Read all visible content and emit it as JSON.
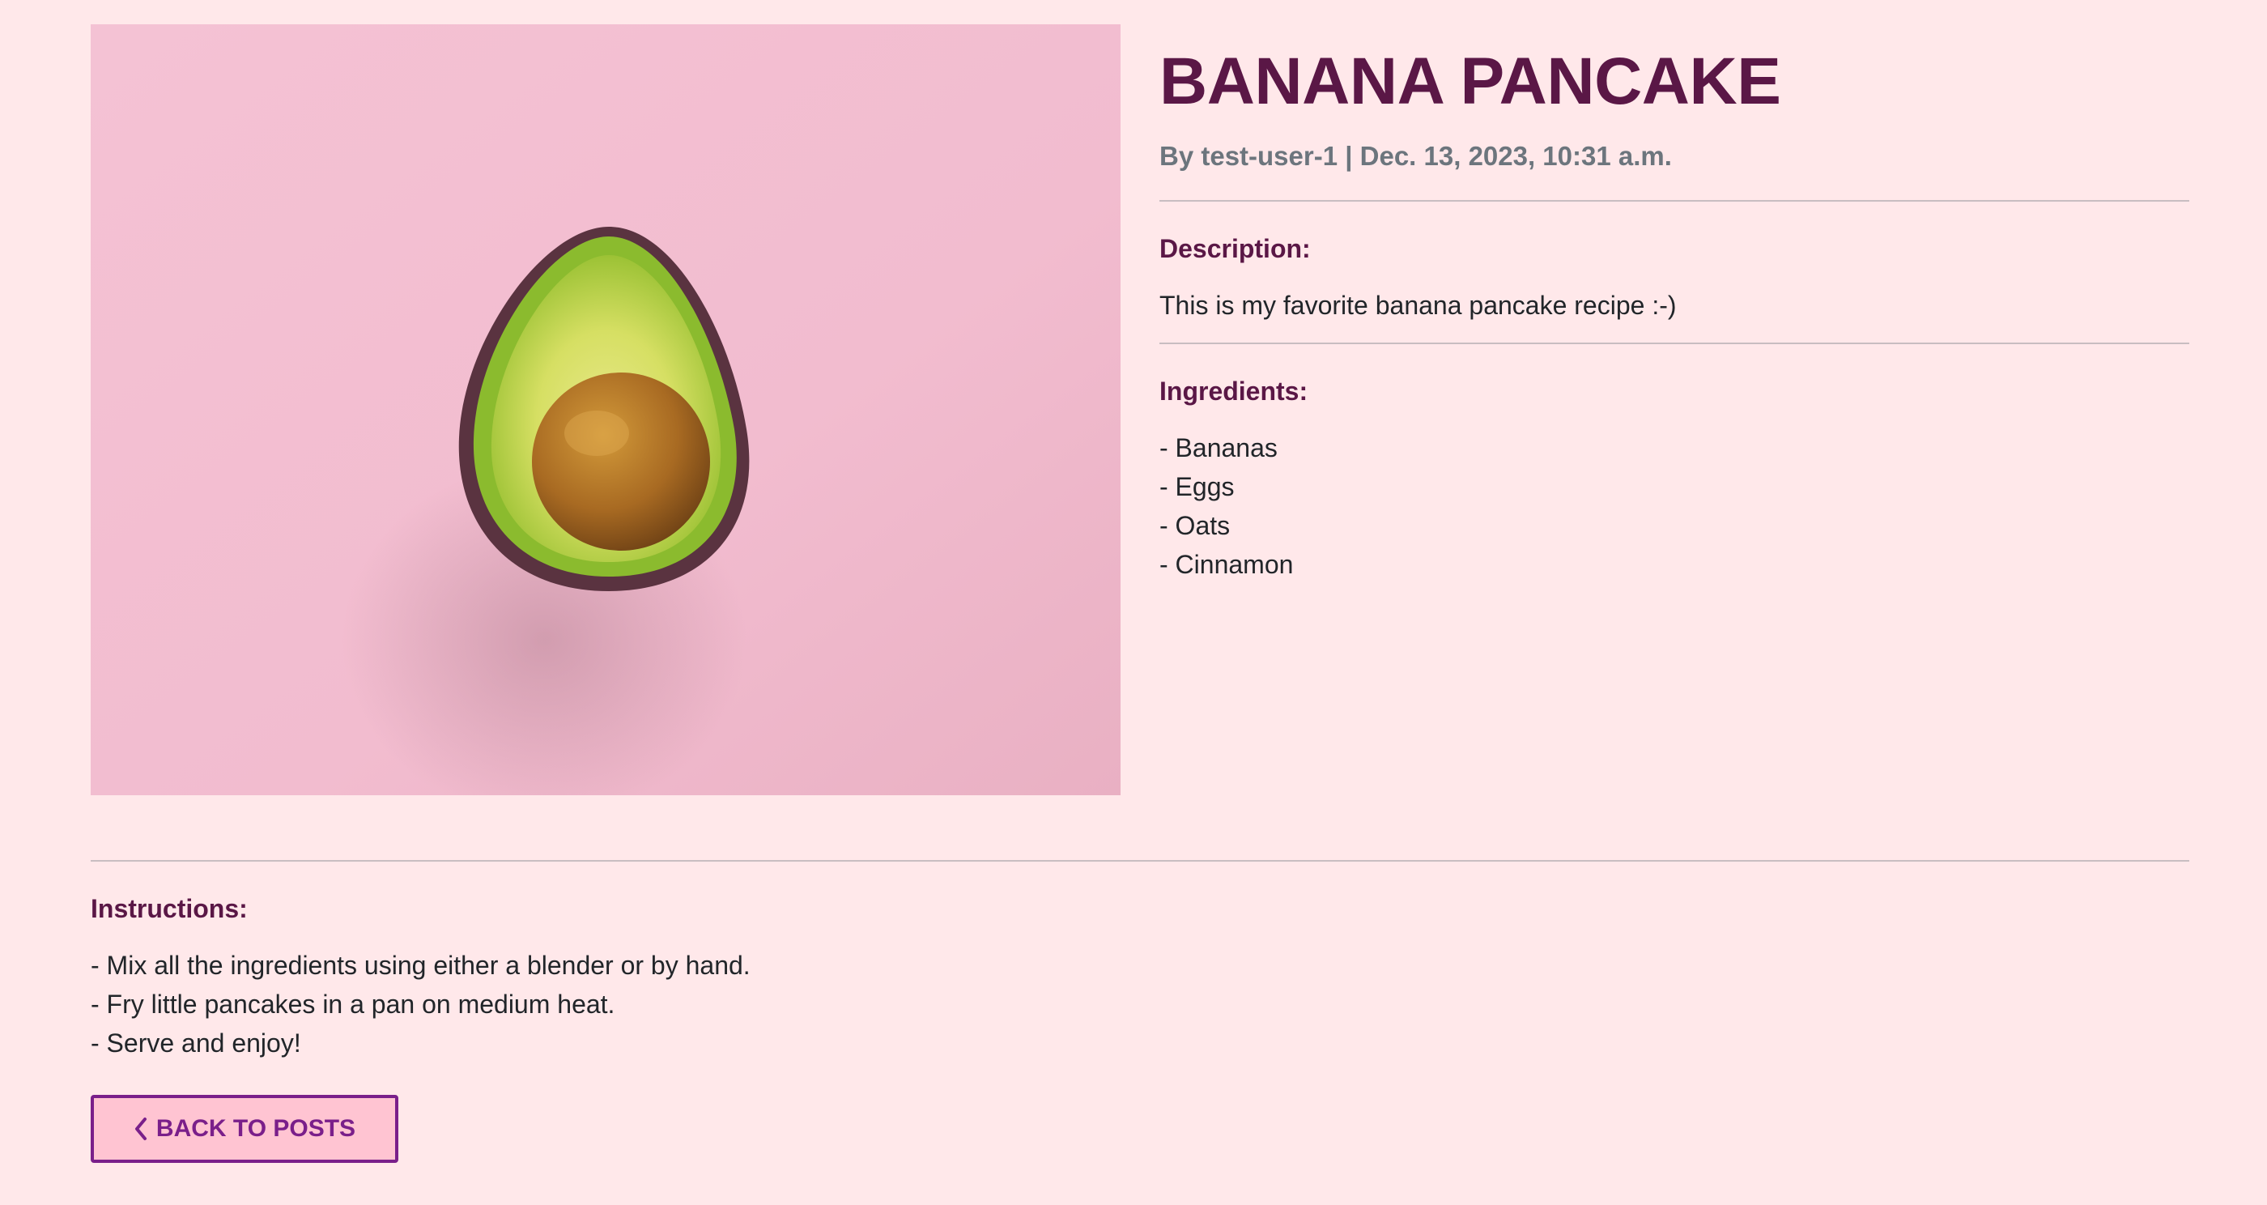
{
  "post": {
    "title": "BANANA PANCAKE",
    "meta": "By test-user-1 | Dec. 13, 2023, 10:31 a.m.",
    "image_subject": "avocado half on pink background"
  },
  "description": {
    "heading": "Description:",
    "text": "This is my favorite banana pancake recipe :-)"
  },
  "ingredients": {
    "heading": "Ingredients:",
    "items": [
      "- Bananas",
      "- Eggs",
      "- Oats",
      "- Cinnamon"
    ]
  },
  "instructions": {
    "heading": "Instructions:",
    "items": [
      "- Mix all the ingredients using either a blender or by hand.",
      "- Fry little pancakes in a pan on medium heat.",
      "- Serve and enjoy!"
    ]
  },
  "back_button": {
    "label": "BACK TO POSTS",
    "icon": "chevron-left-icon"
  },
  "colors": {
    "page_bg": "#ffe8ea",
    "heading": "#5a1746",
    "meta": "#6c757d",
    "button_bg": "#ffc4d2",
    "button_border": "#7a1f8a"
  }
}
